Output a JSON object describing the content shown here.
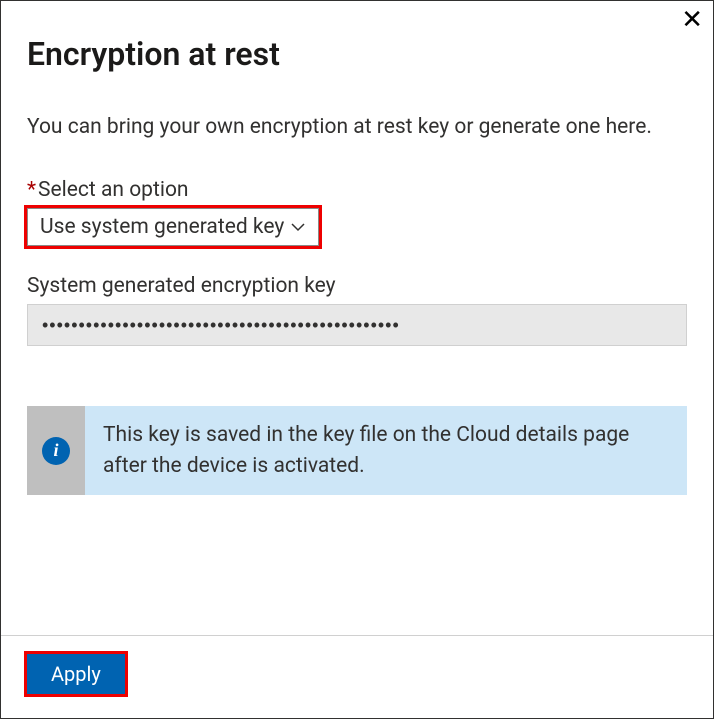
{
  "header": {
    "title": "Encryption at rest"
  },
  "description": "You can bring your own encryption at rest key or generate one here.",
  "option_field": {
    "label": "Select an option",
    "required_marker": "*",
    "selected": "Use system generated key"
  },
  "generated_key": {
    "label": "System generated encryption key",
    "masked_value": "•••••••••••••••••••••••••••••••••••••••••••••••••"
  },
  "info": {
    "text": "This key is saved in the key file on the Cloud details page after the device is activated."
  },
  "footer": {
    "apply_label": "Apply"
  }
}
